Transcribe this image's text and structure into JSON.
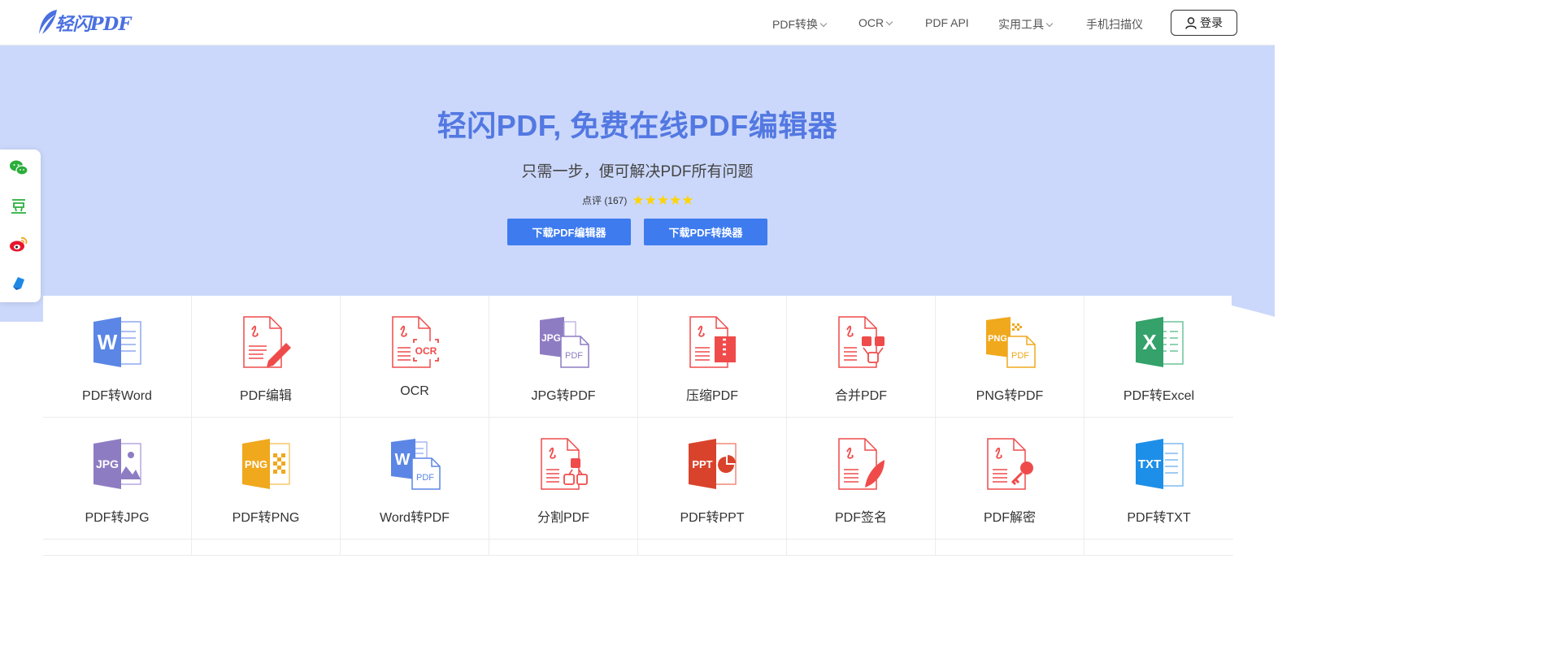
{
  "header": {
    "logo_text": "轻闪PDF",
    "nav": [
      {
        "label": "PDF转换",
        "dropdown": true
      },
      {
        "label": "OCR",
        "dropdown": true
      },
      {
        "label": "PDF API",
        "dropdown": false
      },
      {
        "label": "实用工具",
        "dropdown": true
      },
      {
        "label": "手机扫描仪",
        "dropdown": false
      }
    ],
    "login_label": "登录"
  },
  "hero": {
    "title": "轻闪PDF, 免费在线PDF编辑器",
    "subtitle": "只需一步，便可解决PDF所有问题",
    "rating_label": "点评 (167)",
    "stars": 5,
    "buttons": [
      "下载PDF编辑器",
      "下载PDF转换器"
    ]
  },
  "share": [
    "wechat-icon",
    "douban-icon",
    "weibo-icon",
    "note-icon"
  ],
  "tools": [
    {
      "label": "PDF转Word",
      "icon": "word-icon"
    },
    {
      "label": "PDF编辑",
      "icon": "pdf-edit-icon"
    },
    {
      "label": "OCR",
      "icon": "ocr-icon"
    },
    {
      "label": "JPG转PDF",
      "icon": "jpg-to-pdf-icon"
    },
    {
      "label": "压缩PDF",
      "icon": "compress-pdf-icon"
    },
    {
      "label": "合并PDF",
      "icon": "merge-pdf-icon"
    },
    {
      "label": "PNG转PDF",
      "icon": "png-to-pdf-icon"
    },
    {
      "label": "PDF转Excel",
      "icon": "excel-icon"
    },
    {
      "label": "PDF转JPG",
      "icon": "jpg-icon"
    },
    {
      "label": "PDF转PNG",
      "icon": "png-icon"
    },
    {
      "label": "Word转PDF",
      "icon": "word-to-pdf-icon"
    },
    {
      "label": "分割PDF",
      "icon": "split-pdf-icon"
    },
    {
      "label": "PDF转PPT",
      "icon": "ppt-icon"
    },
    {
      "label": "PDF签名",
      "icon": "pdf-sign-icon"
    },
    {
      "label": "PDF解密",
      "icon": "pdf-decrypt-icon"
    },
    {
      "label": "PDF转TXT",
      "icon": "txt-icon"
    }
  ],
  "colors": {
    "accent": "#3d7bef",
    "hero_bg": "#cbd8fb",
    "title": "#5378e2",
    "pdf_red": "#ef4b4b",
    "star": "#ffd400"
  }
}
